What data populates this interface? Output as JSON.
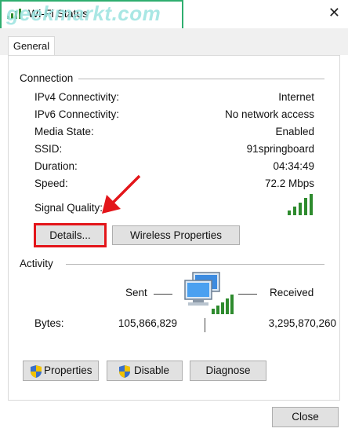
{
  "window": {
    "title": "Wi-Fi Status",
    "close_glyph": "✕",
    "watermark": "geekmarkt.com"
  },
  "tabs": [
    {
      "label": "General",
      "selected": true
    }
  ],
  "connection": {
    "title": "Connection",
    "rows": [
      {
        "label": "IPv4 Connectivity:",
        "value": "Internet"
      },
      {
        "label": "IPv6 Connectivity:",
        "value": "No network access"
      },
      {
        "label": "Media State:",
        "value": "Enabled"
      },
      {
        "label": "SSID:",
        "value": "91springboard"
      },
      {
        "label": "Duration:",
        "value": "04:34:49"
      },
      {
        "label": "Speed:",
        "value": "72.2 Mbps"
      }
    ],
    "signal_label": "Signal Quality:",
    "signal_bars": 5,
    "signal_icon": "signal-bars-icon",
    "details_button": "Details...",
    "wireless_button": "Wireless Properties"
  },
  "activity": {
    "title": "Activity",
    "sent_label": "Sent",
    "received_label": "Received",
    "bytes_label": "Bytes:",
    "bytes_sent": "105,866,829",
    "bytes_received": "3,295,870,260",
    "network_icon": "network-computers-icon"
  },
  "buttons": {
    "properties": "Properties",
    "disable": "Disable",
    "diagnose": "Diagnose",
    "close": "Close"
  },
  "colors": {
    "highlight": "#e3151a",
    "signal": "#2e8b2e",
    "watermark": "#9be3e0",
    "watermark_border": "#2fae6f"
  }
}
